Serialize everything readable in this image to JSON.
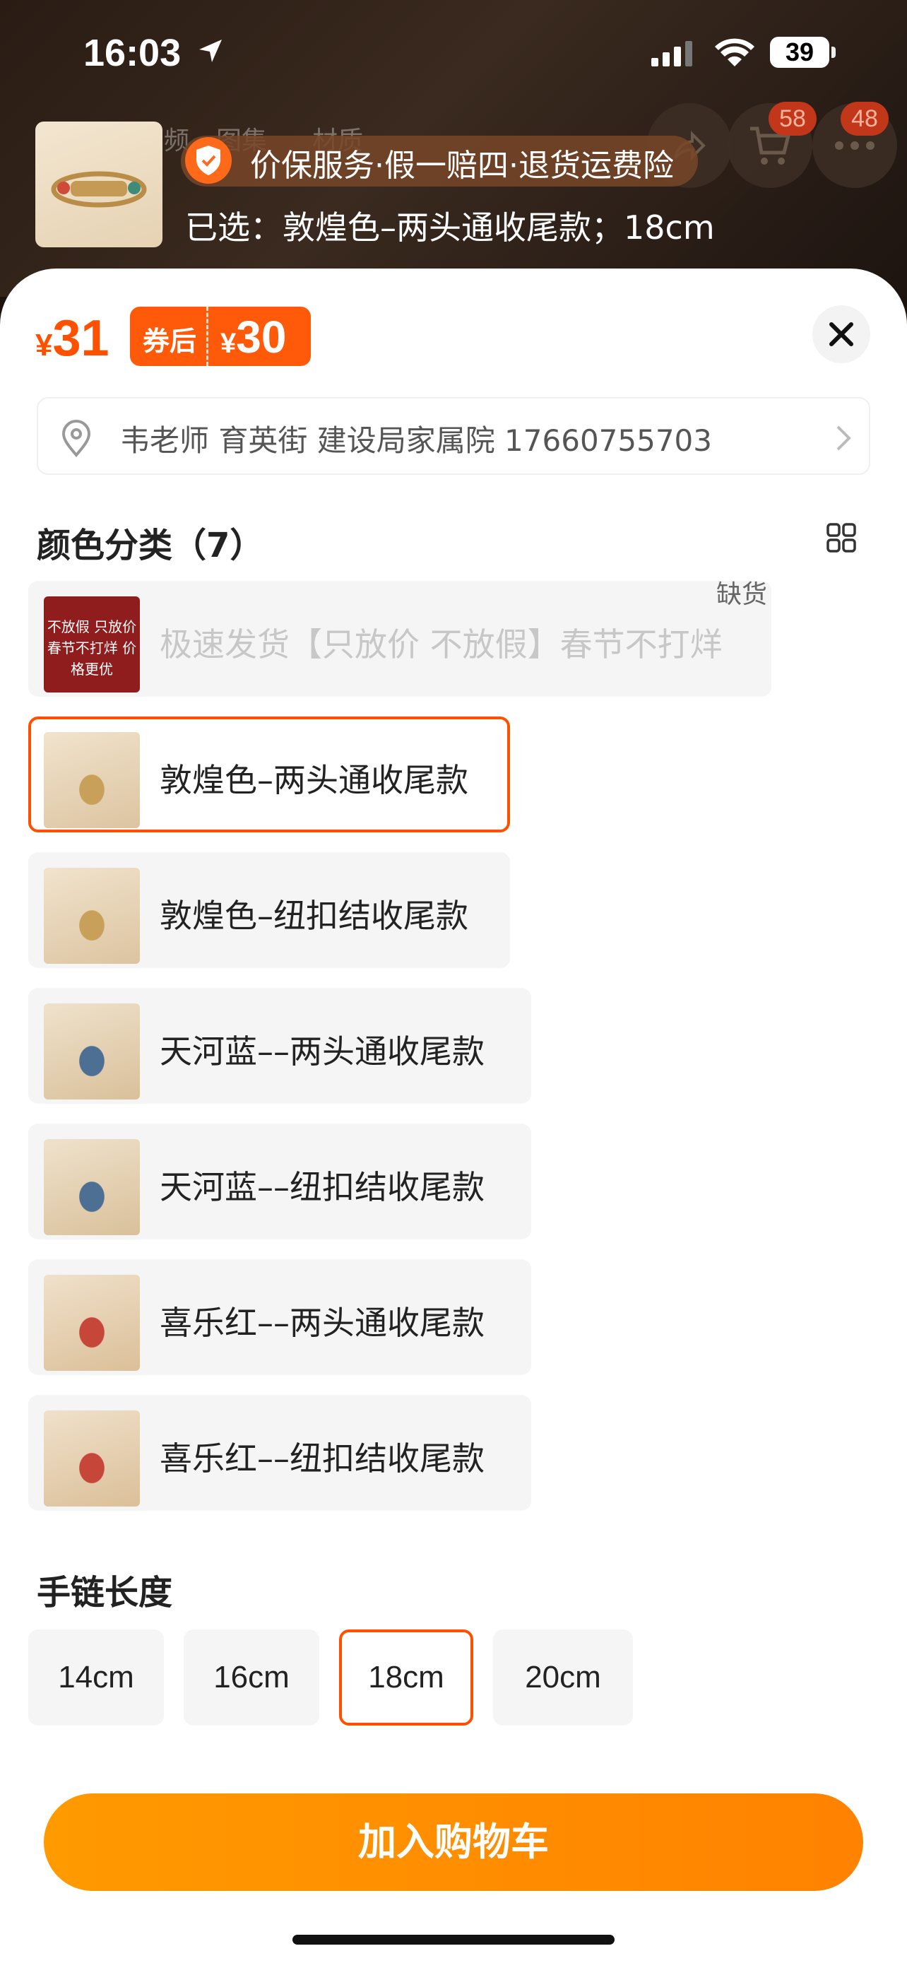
{
  "status_bar": {
    "time": "16:03",
    "battery": "39"
  },
  "header": {
    "ghost_tabs": [
      "频",
      "图集",
      "材质"
    ],
    "cart_badge": "58",
    "more_badge": "48",
    "service_text": "价保服务·假一赔四·退货运费险",
    "selected_text": "已选：敦煌色–两头通收尾款；18cm"
  },
  "price": {
    "symbol": "¥",
    "original": "31",
    "coupon_label": "券后",
    "coupon_symbol": "¥",
    "coupon_price": "30"
  },
  "address": {
    "text": "韦老师 育英街 建设局家属院 17660755703"
  },
  "color_section": {
    "title": "颜色分类（7）",
    "out_of_stock_label": "缺货",
    "promo_thumb_text": [
      "不放假 只放价",
      "春节不打烊 价格更优"
    ],
    "options": [
      {
        "label": "极速发货【只放价 不放假】春节不打烊",
        "state": "disabled"
      },
      {
        "label": "敦煌色–两头通收尾款",
        "state": "selected"
      },
      {
        "label": "敦煌色–纽扣结收尾款",
        "state": "normal"
      },
      {
        "label": "天河蓝––两头通收尾款",
        "state": "normal"
      },
      {
        "label": "天河蓝––纽扣结收尾款",
        "state": "normal"
      },
      {
        "label": "喜乐红––两头通收尾款",
        "state": "normal"
      },
      {
        "label": "喜乐红––纽扣结收尾款",
        "state": "normal"
      }
    ]
  },
  "length_section": {
    "title": "手链长度",
    "sizes": [
      "14cm",
      "16cm",
      "18cm",
      "20cm"
    ],
    "selected": "18cm"
  },
  "cart_button": {
    "label": "加入购物车"
  },
  "colors": {
    "accent": "#ff5000",
    "button": "#ff8c00"
  }
}
